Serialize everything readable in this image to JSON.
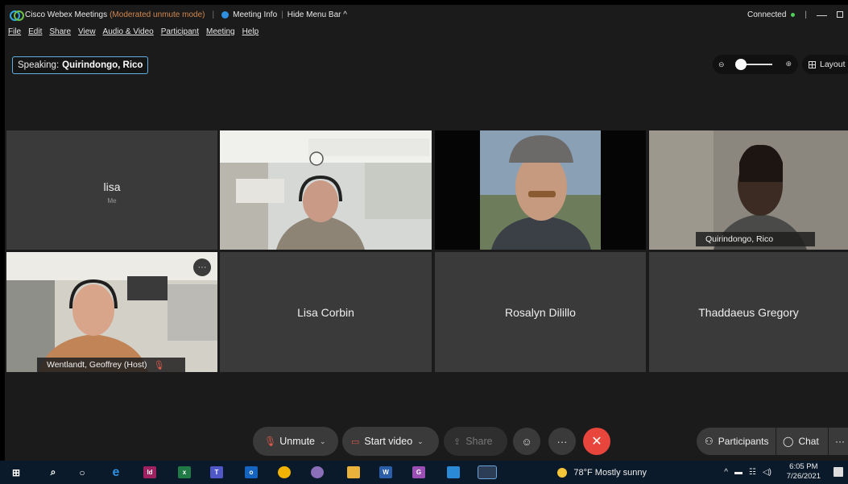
{
  "titlebar": {
    "app_name": "Cisco Webex Meetings",
    "mode": "(Moderated unmute mode)",
    "meeting_info": "Meeting Info",
    "hide_menu": "Hide Menu Bar",
    "connection": "Connected",
    "status_color": "#4fcf5a"
  },
  "menu": [
    "File",
    "Edit",
    "Share",
    "View",
    "Audio & Video",
    "Participant",
    "Meeting",
    "Help"
  ],
  "speaking": {
    "prefix": "Speaking:",
    "name": "Quirindongo, Rico"
  },
  "layout_label": "Layout",
  "tiles": {
    "lisa": {
      "name": "lisa",
      "sub": "Me"
    },
    "rico": {
      "name": "Quirindongo, Rico"
    },
    "geoffrey": {
      "name": "Wentlandt, Geoffrey (Host)"
    },
    "corbin": {
      "name": "Lisa Corbin"
    },
    "dilillo": {
      "name": "Rosalyn Dilillo"
    },
    "gregory": {
      "name": "Thaddaeus Gregory"
    }
  },
  "controls": {
    "unmute": "Unmute",
    "start_video": "Start video",
    "share": "Share",
    "participants": "Participants",
    "chat": "Chat"
  },
  "taskbar": {
    "weather": "78°F  Mostly sunny",
    "time": "6:05 PM",
    "date": "7/26/2021"
  },
  "accent": "#39a9dc",
  "end_color": "#e8453c"
}
